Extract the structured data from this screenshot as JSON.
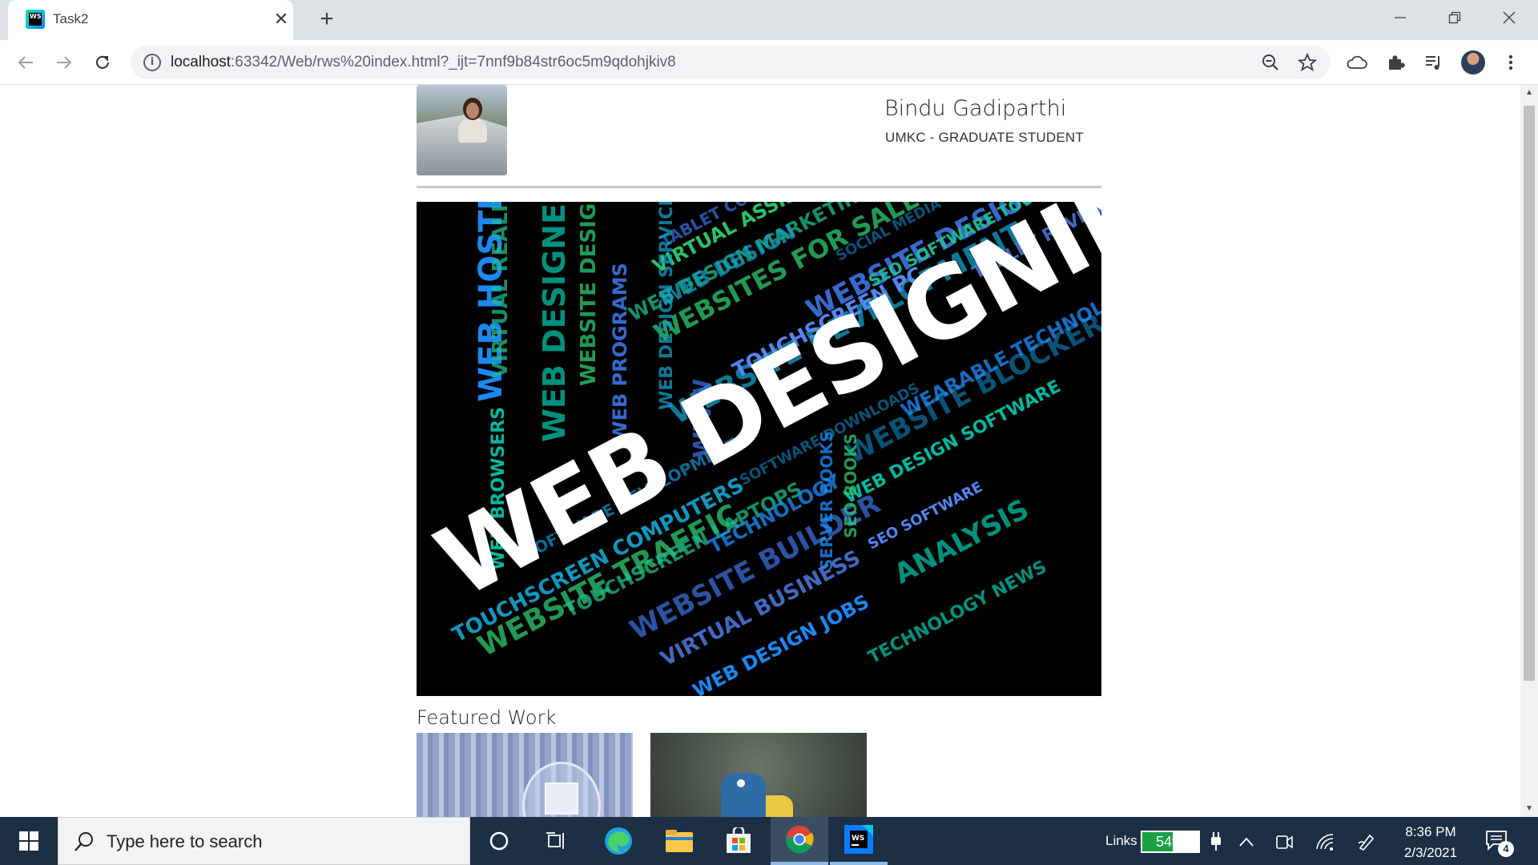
{
  "browser": {
    "tab_title": "Task2",
    "favicon_text": "WS",
    "url_host": "localhost",
    "url_rest": ":63342/Web/rws%20index.html?_ijt=7nnf9b84str6oc5m9qdohjkiv8"
  },
  "page": {
    "name": "Bindu Gadiparthi",
    "subtitle": "UMKC - GRADUATE STUDENT",
    "hero_main_text": "WEB DESIGNING",
    "featured_title": "Featured Work",
    "word_cloud": [
      "WEB HOSTING",
      "WEB DESIGNERS",
      "WEBSITES FOR SALE",
      "WEBSITE DESIGN",
      "WEBSITE DEVELOPMENT",
      "WEB DESIGN MARKETING",
      "TOUCHSCREEN PC",
      "WEBSITE BLOCKER",
      "WEARABLE TECHNOLOGY",
      "WEB DESIGN SOFTWARE",
      "WEBSITE TRAFFIC",
      "WEBSITE BUILDER",
      "TOUCHSCREEN COMPUTERS",
      "TOUCHSCREEN LAPTOPS",
      "VIRTUAL BUSINESS",
      "SOFTWARE DEVELOPMENT",
      "TECHNOLOGY",
      "ANALYSIS",
      "VIRTUAL ASSISTANT",
      "TABLET COMPUTERS",
      "WEB DESIGN",
      "SEO SOFTWARE TOOLS",
      "TABLET REVIEWS",
      "SOCIAL MEDIA",
      "WEB DESIGN JOBS",
      "TECHNOLOGY NEWS",
      "WEBSITE DESIGNER",
      "WEB PROGRAMS",
      "WEB DESIGN SERVICES",
      "VIRTUAL REALITY",
      "SEO SOFTWARE",
      "SOFTWARE DOWNLOADS",
      "SERVER BOOKS",
      "WEB BROWSERS",
      "SEO BOOKS",
      "WWW"
    ]
  },
  "taskbar": {
    "search_placeholder": "Type here to search",
    "links_label": "Links",
    "battery_percent": "54%",
    "battery_level": 0.54,
    "time": "8:36 PM",
    "date": "2/3/2021",
    "notification_count": "4"
  },
  "colors": {
    "chrome_tabstrip": "#dee1e6",
    "taskbar": "#1c2f44",
    "battery_fill": "#1b9f47",
    "hero_background": "#000000",
    "word_cloud_palette": [
      "#1e90ff",
      "#00c2a8",
      "#2ecc71",
      "#3a6fd8",
      "#14a0c8",
      "#1fbf8f",
      "#5a8cff",
      "#0f6e9e"
    ]
  }
}
